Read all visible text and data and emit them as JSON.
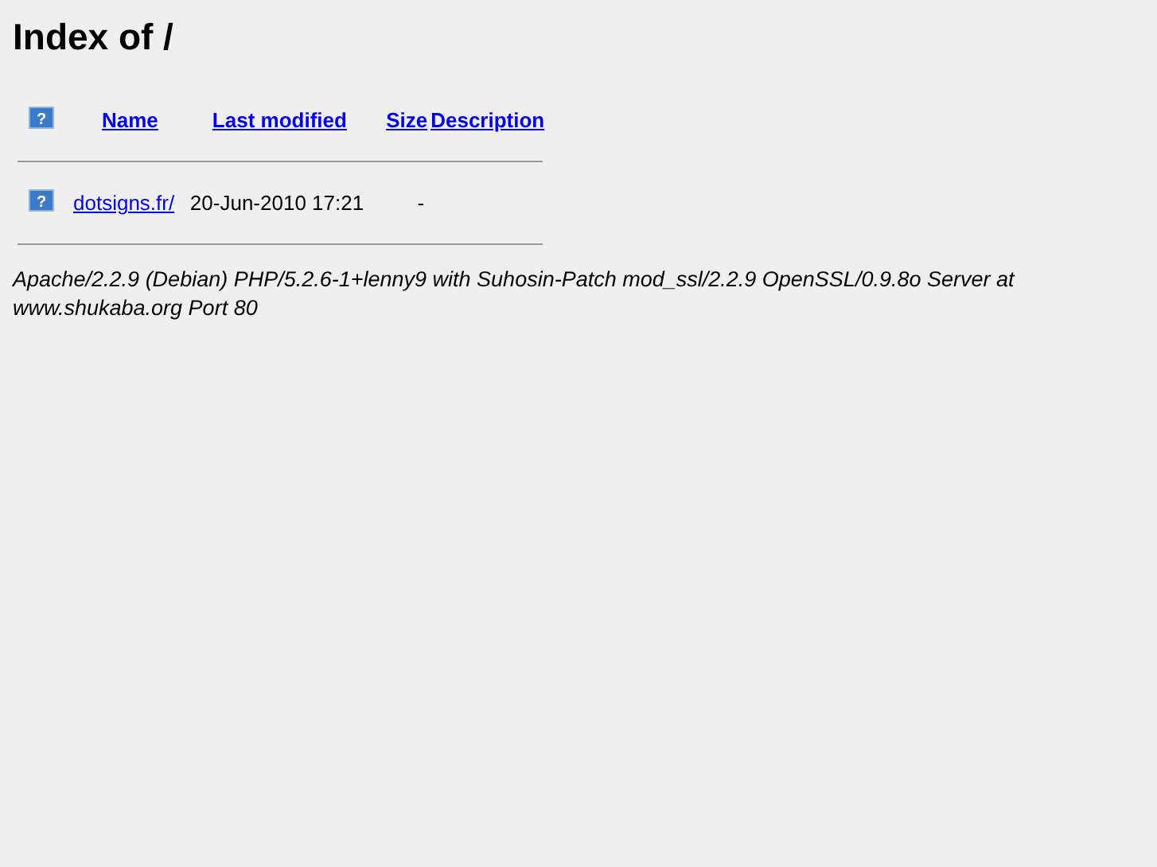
{
  "title": "Index of /",
  "table": {
    "header_icon": "?",
    "columns": [
      "Name",
      "Last modified",
      "Size",
      "Description"
    ],
    "rows": [
      {
        "icon": "?",
        "name": "dotsigns.fr/",
        "last_modified": "20-Jun-2010 17:21",
        "size": "-"
      }
    ]
  },
  "address": "Apache/2.2.9 (Debian) PHP/5.2.6-1+lenny9 with Suhosin-Patch mod_ssl/2.2.9 OpenSSL/0.9.8o Server at www.shukaba.org Port 80"
}
